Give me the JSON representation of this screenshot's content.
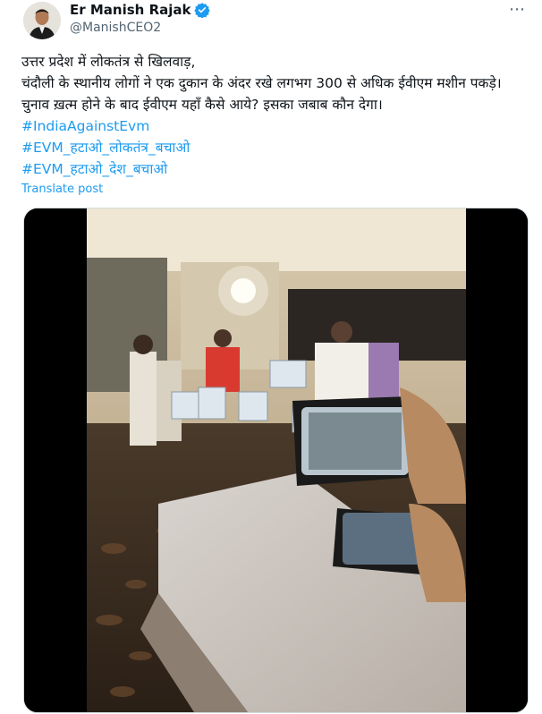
{
  "author": {
    "display_name": "Er Manish Rajak",
    "handle": "@ManishCEO2",
    "verified_icon": "verified-badge-icon",
    "avatar_icon": "profile-photo"
  },
  "more_icon": "⋯",
  "post": {
    "lines": [
      "उत्तर प्रदेश में लोकतंत्र से खिलवाड़,",
      "चंदौली के स्थानीय लोगों ने एक दुकान के अंदर रखे  लगभग 300 से अधिक ईवीएम मशीन पकड़े। चुनाव ख़त्म होने के बाद ईवीएम यहाँ कैसे आये? इसका जबाब कौन देगा।"
    ],
    "hashtags": [
      "#IndiaAgainstEvm",
      "#EVM_हटाओ_लोकतंत्र_बचाओ",
      "#EVM_हटाओ_देश_बचाओ"
    ],
    "translate_label": "Translate post"
  },
  "media": {
    "type": "video",
    "accent_color": "#1d9bf0"
  }
}
